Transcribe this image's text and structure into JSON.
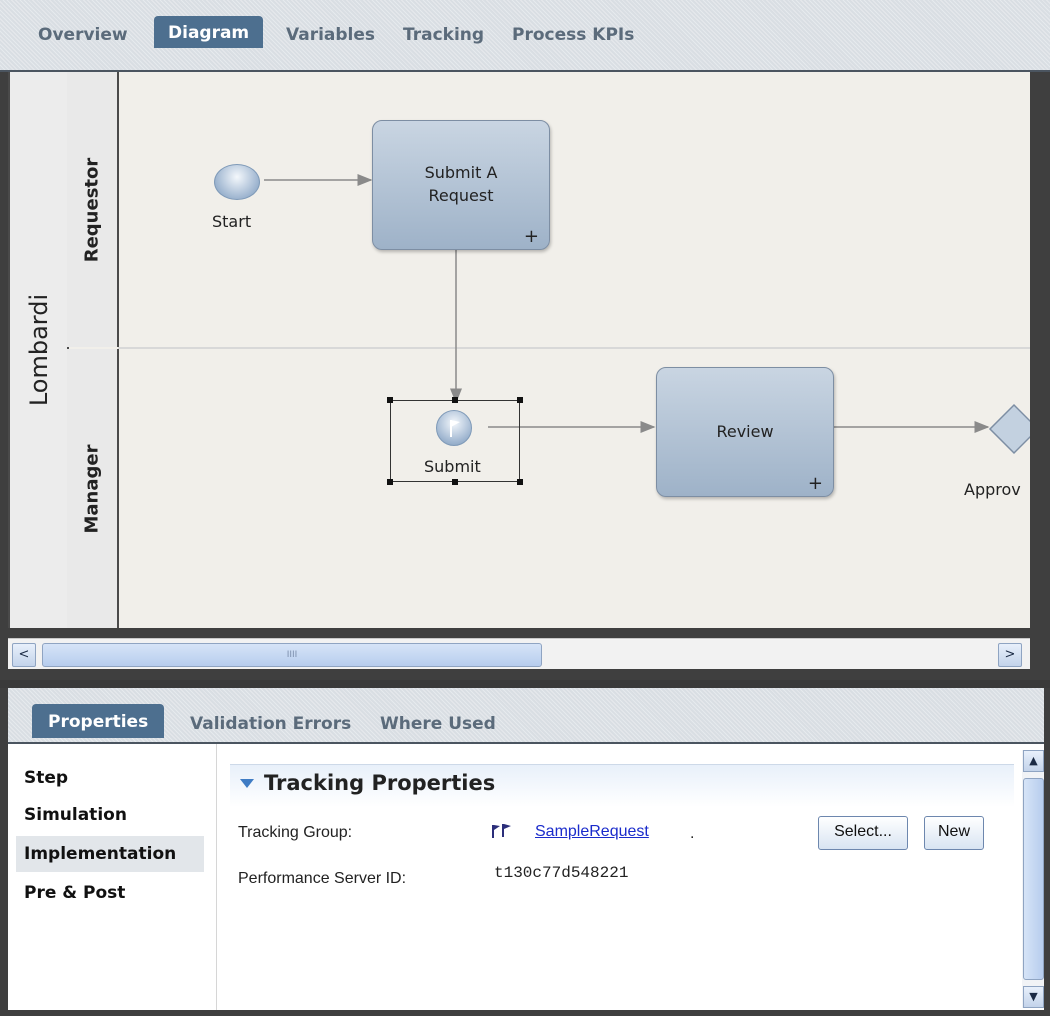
{
  "top_tabs": {
    "overview": "Overview",
    "diagram": "Diagram",
    "variables": "Variables",
    "tracking": "Tracking",
    "process_kpis": "Process KPIs"
  },
  "diagram": {
    "pool": "Lombardi",
    "lanes": {
      "requestor": "Requestor",
      "manager": "Manager"
    },
    "start_label": "Start",
    "activity1_line1": "Submit A",
    "activity1_line2": "Request",
    "activity_plus": "+",
    "submit_label": "Submit",
    "review_label": "Review",
    "gateway_label": "Approv"
  },
  "hscroll": {
    "grip": "IIII",
    "left": "<",
    "right": ">"
  },
  "bottom_tabs": {
    "properties": "Properties",
    "validation": "Validation Errors",
    "where_used": "Where Used"
  },
  "nav": {
    "step": "Step",
    "simulation": "Simulation",
    "implementation": "Implementation",
    "pre_post": "Pre & Post"
  },
  "tracking": {
    "section_title": "Tracking Properties",
    "group_label": "Tracking Group:",
    "group_value": "SampleRequest",
    "group_dot": ".",
    "server_label": "Performance Server ID:",
    "server_value": "t130c77d548221",
    "select_button": "Select...",
    "new_button": "New"
  },
  "vscroll": {
    "up": "▲",
    "down": "▼"
  },
  "colors": {
    "active_tab": "#4d6f8f",
    "node_fill": "#9eb2c8",
    "link": "#1a2bcb",
    "flag": "#2b2e7a"
  }
}
